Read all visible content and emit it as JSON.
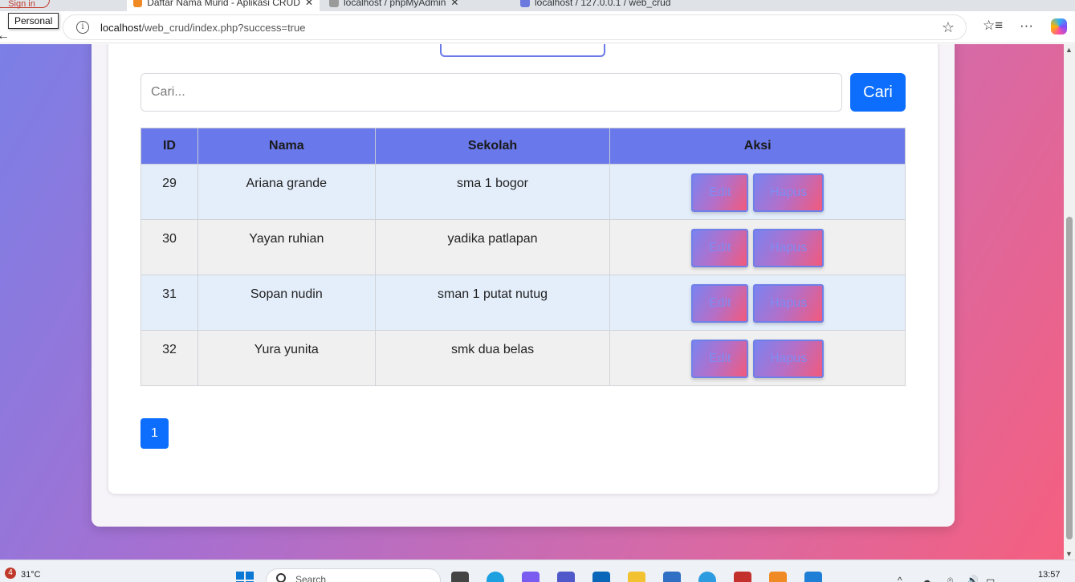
{
  "browser": {
    "tabs": [
      {
        "label": "Daftar Nama Murid - Aplikasi CRUD",
        "active": true
      },
      {
        "label": "localhost / phpMyAdmin",
        "active": false
      },
      {
        "label": "localhost / 127.0.0.1 / web_crud",
        "active": false
      }
    ],
    "signin_label": "Sign in",
    "profile_tooltip": "Personal",
    "url_host": "localhost",
    "url_path": "/web_crud/index.php?success=true"
  },
  "page": {
    "search": {
      "placeholder": "Cari...",
      "button_label": "Cari"
    },
    "table": {
      "headers": [
        "ID",
        "Nama",
        "Sekolah",
        "Aksi"
      ],
      "rows": [
        {
          "id": "29",
          "nama": "Ariana grande",
          "sekolah": "sma 1 bogor"
        },
        {
          "id": "30",
          "nama": "Yayan ruhian",
          "sekolah": "yadika patlapan"
        },
        {
          "id": "31",
          "nama": "Sopan nudin",
          "sekolah": "sman 1 putat nutug"
        },
        {
          "id": "32",
          "nama": "Yura yunita",
          "sekolah": "smk dua belas"
        }
      ],
      "edit_label": "Edit",
      "delete_label": "Hapus"
    },
    "pagination": {
      "current_page": "1"
    }
  },
  "taskbar": {
    "notification_count": "4",
    "weather": "31°C",
    "search_placeholder": "Search",
    "time": "13:57"
  },
  "colors": {
    "primary_button": "#0d6efd",
    "table_header": "#6978ea",
    "odd_row": "#e4eefb",
    "even_row": "#f0f0f0"
  }
}
